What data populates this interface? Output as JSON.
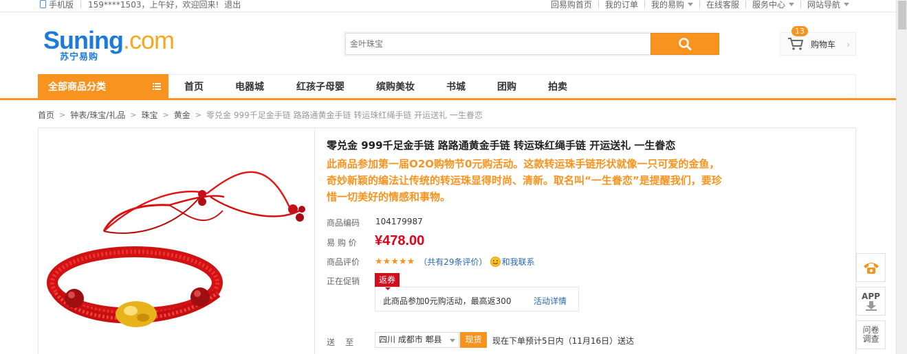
{
  "topbar": {
    "mobile": "手机版",
    "greeting": "159****1503，上午好，欢迎回来!",
    "logout": "退出",
    "links": [
      {
        "label": "回易购首页",
        "dropdown": false
      },
      {
        "label": "我的订单",
        "dropdown": false
      },
      {
        "label": "我的易购",
        "dropdown": true
      },
      {
        "label": "在线客服",
        "dropdown": false
      },
      {
        "label": "服务中心",
        "dropdown": true
      },
      {
        "label": "网站导航",
        "dropdown": true
      }
    ]
  },
  "header": {
    "logo_main": "Suning",
    "logo_com": ".com",
    "logo_cn": "苏宁易购",
    "search_placeholder": "金叶珠宝",
    "cart_label": "购物车",
    "cart_count": "13"
  },
  "nav": {
    "all_categories": "全部商品分类",
    "links": [
      "首页",
      "电器城",
      "红孩子母婴",
      "缤购美妆",
      "书城",
      "团购",
      "拍卖"
    ]
  },
  "breadcrumb": [
    "首页",
    "钟表/珠宝/礼品",
    "珠宝",
    "黄金",
    "零兑金 999千足金手链 路路通黄金手链 转运珠红绳手链 开运送礼 一生眷恋"
  ],
  "product": {
    "title": "零兑金 999千足金手链 路路通黄金手链 转运珠红绳手链 开运送礼 一生眷恋",
    "promo": "此商品参加第一届O2O购物节0元购活动。这款转运珠手链形状就像一只可爱的金鱼，奇妙新颖的编法让传统的转运珠显得时尚、清新。取名叫“一生眷恋”是提醒我们，要珍惜一切美好的情感和事物。",
    "code_label": "商品编码",
    "code": "104179987",
    "price_label": "易 购 价",
    "price": "¥478.00",
    "rating_label": "商品评价",
    "rating_stars": 5,
    "review_count": "（共有29条评价）",
    "contact": "和我联系",
    "promo_label": "正在促销",
    "coupon_tag": "返券",
    "coupon_text": "此商品参加0元购活动，最高返300",
    "coupon_link": "活动详情",
    "ship_label": "送    至",
    "address": "四川 成都市 郫县",
    "stock": "现货",
    "delivery": "现在下单预计5日内（11月16日）送达"
  },
  "side": {
    "phone_icon": "phone-icon",
    "app": "APP",
    "survey_line1": "问卷",
    "survey_line2": "调查"
  },
  "colors": {
    "accent": "#f7931e",
    "brand_blue": "#1c7bd9",
    "price_red": "#e4001a",
    "link_blue": "#2969b0"
  }
}
